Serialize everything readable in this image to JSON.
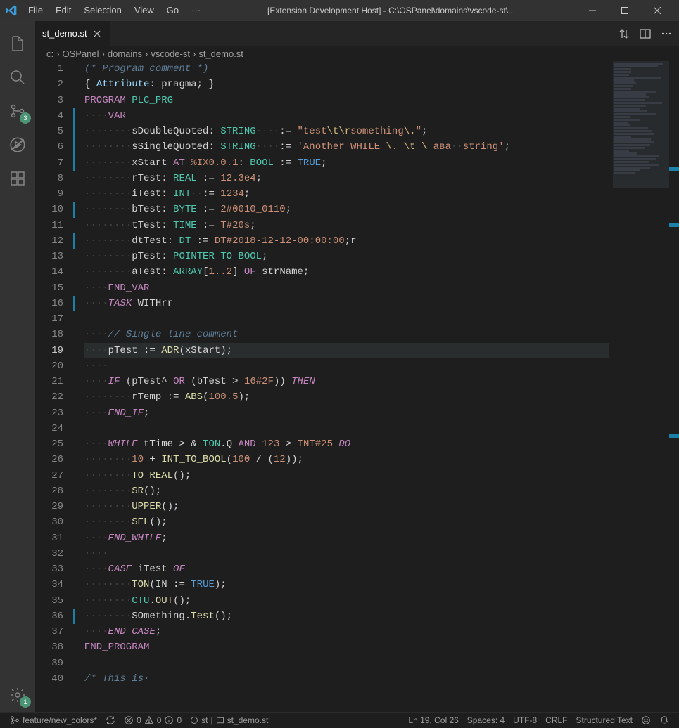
{
  "titlebar": {
    "menu": [
      "File",
      "Edit",
      "Selection",
      "View",
      "Go",
      "···"
    ],
    "title": "[Extension Development Host] - C:\\OSPanel\\domains\\vscode-st\\..."
  },
  "activitybar": {
    "scm_badge": "3",
    "settings_badge": "1"
  },
  "tabs": {
    "active": "st_demo.st"
  },
  "tabs_actions": {},
  "breadcrumbs": [
    "c:",
    "OSPanel",
    "domains",
    "vscode-st",
    "st_demo.st"
  ],
  "lines": {
    "1": {
      "segs": [
        {
          "t": "(* Program comment *)",
          "c": "c-comment"
        }
      ]
    },
    "2": {
      "segs": [
        {
          "t": "{ ",
          "c": "c-punct"
        },
        {
          "t": "Attribute",
          "c": "c-attr"
        },
        {
          "t": ": ",
          "c": "c-punct"
        },
        {
          "t": "pragma",
          "c": "c-ident"
        },
        {
          "t": "; }",
          "c": "c-punct"
        }
      ]
    },
    "3": {
      "segs": [
        {
          "t": "PROGRAM",
          "c": "c-keyword2"
        },
        {
          "t": " ",
          "c": ""
        },
        {
          "t": "PLC_PRG",
          "c": "c-type"
        }
      ]
    },
    "4": {
      "segs": [
        {
          "t": "····",
          "c": "ws"
        },
        {
          "t": "VAR",
          "c": "c-keyword2"
        }
      ]
    },
    "5": {
      "segs": [
        {
          "t": "········",
          "c": "ws"
        },
        {
          "t": "sDoubleQuoted",
          "c": "c-ident"
        },
        {
          "t": ": ",
          "c": "c-punct"
        },
        {
          "t": "STRING",
          "c": "c-type"
        },
        {
          "t": "····",
          "c": "ws"
        },
        {
          "t": ":= ",
          "c": "c-op"
        },
        {
          "t": "\"test",
          "c": "c-string"
        },
        {
          "t": "\\t\\r",
          "c": "c-special"
        },
        {
          "t": "something",
          "c": "c-string"
        },
        {
          "t": "\\.",
          "c": "c-special"
        },
        {
          "t": "\"",
          "c": "c-string"
        },
        {
          "t": ";",
          "c": "c-punct"
        }
      ]
    },
    "6": {
      "segs": [
        {
          "t": "········",
          "c": "ws"
        },
        {
          "t": "sSingleQuoted",
          "c": "c-ident"
        },
        {
          "t": ": ",
          "c": "c-punct"
        },
        {
          "t": "STRING",
          "c": "c-type"
        },
        {
          "t": "····",
          "c": "ws"
        },
        {
          "t": ":= ",
          "c": "c-op"
        },
        {
          "t": "'Another WHILE ",
          "c": "c-string"
        },
        {
          "t": "\\.",
          "c": "c-special"
        },
        {
          "t": " ",
          "c": "c-string"
        },
        {
          "t": "\\t",
          "c": "c-special"
        },
        {
          "t": " ",
          "c": "c-string"
        },
        {
          "t": "\\",
          "c": "c-special"
        },
        {
          "t": " ава",
          "c": "c-string"
        },
        {
          "t": "··",
          "c": "ws"
        },
        {
          "t": "string'",
          "c": "c-string"
        },
        {
          "t": ";",
          "c": "c-punct"
        }
      ]
    },
    "7": {
      "segs": [
        {
          "t": "········",
          "c": "ws"
        },
        {
          "t": "xStart",
          "c": "c-ident"
        },
        {
          "t": " ",
          "c": ""
        },
        {
          "t": "AT",
          "c": "c-keyword2"
        },
        {
          "t": " ",
          "c": ""
        },
        {
          "t": "%IX0.0.1",
          "c": "c-number"
        },
        {
          "t": ": ",
          "c": "c-punct"
        },
        {
          "t": "BOOL",
          "c": "c-type"
        },
        {
          "t": " := ",
          "c": "c-op"
        },
        {
          "t": "TRUE",
          "c": "c-bool"
        },
        {
          "t": ";",
          "c": "c-punct"
        }
      ]
    },
    "8": {
      "segs": [
        {
          "t": "········",
          "c": "ws"
        },
        {
          "t": "rTest",
          "c": "c-ident"
        },
        {
          "t": ": ",
          "c": "c-punct"
        },
        {
          "t": "REAL",
          "c": "c-type"
        },
        {
          "t": " := ",
          "c": "c-op"
        },
        {
          "t": "12.3e4",
          "c": "c-number"
        },
        {
          "t": ";",
          "c": "c-punct"
        }
      ]
    },
    "9": {
      "segs": [
        {
          "t": "········",
          "c": "ws"
        },
        {
          "t": "iTest",
          "c": "c-ident"
        },
        {
          "t": ": ",
          "c": "c-punct"
        },
        {
          "t": "INT",
          "c": "c-type"
        },
        {
          "t": "··",
          "c": "ws"
        },
        {
          "t": ":= ",
          "c": "c-op"
        },
        {
          "t": "1234",
          "c": "c-number"
        },
        {
          "t": ";",
          "c": "c-punct"
        }
      ]
    },
    "10": {
      "segs": [
        {
          "t": "········",
          "c": "ws"
        },
        {
          "t": "bTest",
          "c": "c-ident"
        },
        {
          "t": ": ",
          "c": "c-punct"
        },
        {
          "t": "BYTE",
          "c": "c-type"
        },
        {
          "t": " := ",
          "c": "c-op"
        },
        {
          "t": "2#0010_0110",
          "c": "c-number"
        },
        {
          "t": ";",
          "c": "c-punct"
        }
      ]
    },
    "11": {
      "segs": [
        {
          "t": "········",
          "c": "ws"
        },
        {
          "t": "tTest",
          "c": "c-ident"
        },
        {
          "t": ": ",
          "c": "c-punct"
        },
        {
          "t": "TIME",
          "c": "c-type"
        },
        {
          "t": " := ",
          "c": "c-op"
        },
        {
          "t": "T#20s",
          "c": "c-number"
        },
        {
          "t": ";",
          "c": "c-punct"
        }
      ]
    },
    "12": {
      "segs": [
        {
          "t": "········",
          "c": "ws"
        },
        {
          "t": "dtTest",
          "c": "c-ident"
        },
        {
          "t": ": ",
          "c": "c-punct"
        },
        {
          "t": "DT",
          "c": "c-type"
        },
        {
          "t": " := ",
          "c": "c-op"
        },
        {
          "t": "DT#2018-12-12-00:00:00",
          "c": "c-number"
        },
        {
          "t": ";",
          "c": "c-punct"
        },
        {
          "t": "r",
          "c": "c-ident"
        }
      ]
    },
    "13": {
      "segs": [
        {
          "t": "········",
          "c": "ws"
        },
        {
          "t": "pTest",
          "c": "c-ident"
        },
        {
          "t": ": ",
          "c": "c-punct"
        },
        {
          "t": "POINTER TO BOOL",
          "c": "c-type"
        },
        {
          "t": ";",
          "c": "c-punct"
        }
      ]
    },
    "14": {
      "segs": [
        {
          "t": "········",
          "c": "ws"
        },
        {
          "t": "aTest",
          "c": "c-ident"
        },
        {
          "t": ": ",
          "c": "c-punct"
        },
        {
          "t": "ARRAY",
          "c": "c-type"
        },
        {
          "t": "[",
          "c": "c-punct"
        },
        {
          "t": "1..2",
          "c": "c-number"
        },
        {
          "t": "] ",
          "c": "c-punct"
        },
        {
          "t": "OF",
          "c": "c-keyword2"
        },
        {
          "t": " ",
          "c": ""
        },
        {
          "t": "strName",
          "c": "c-ident"
        },
        {
          "t": ";",
          "c": "c-punct"
        }
      ]
    },
    "15": {
      "segs": [
        {
          "t": "····",
          "c": "ws"
        },
        {
          "t": "END_VAR",
          "c": "c-keyword2"
        }
      ]
    },
    "16": {
      "segs": [
        {
          "t": "····",
          "c": "ws"
        },
        {
          "t": "TASK",
          "c": "c-keyword"
        },
        {
          "t": " ",
          "c": ""
        },
        {
          "t": "WITHrr",
          "c": "c-ident"
        }
      ]
    },
    "17": {
      "segs": []
    },
    "18": {
      "segs": [
        {
          "t": "····",
          "c": "ws"
        },
        {
          "t": "// Single line comment",
          "c": "c-comment"
        }
      ]
    },
    "19": {
      "segs": [
        {
          "t": "····",
          "c": "ws"
        },
        {
          "t": "pTest",
          "c": "c-ident"
        },
        {
          "t": " := ",
          "c": "c-op"
        },
        {
          "t": "ADR",
          "c": "c-func"
        },
        {
          "t": "(",
          "c": "c-punct"
        },
        {
          "t": "xStart",
          "c": "c-ident"
        },
        {
          "t": ");",
          "c": "c-punct"
        }
      ]
    },
    "20": {
      "segs": [
        {
          "t": "····",
          "c": "ws"
        }
      ]
    },
    "21": {
      "segs": [
        {
          "t": "····",
          "c": "ws"
        },
        {
          "t": "IF",
          "c": "c-keyword"
        },
        {
          "t": " (",
          "c": "c-punct"
        },
        {
          "t": "pTest",
          "c": "c-ident"
        },
        {
          "t": "^ ",
          "c": "c-op"
        },
        {
          "t": "OR",
          "c": "c-keyword2"
        },
        {
          "t": " (",
          "c": "c-punct"
        },
        {
          "t": "bTest",
          "c": "c-ident"
        },
        {
          "t": " > ",
          "c": "c-op"
        },
        {
          "t": "16#2F",
          "c": "c-number"
        },
        {
          "t": ")) ",
          "c": "c-punct"
        },
        {
          "t": "THEN",
          "c": "c-keyword"
        }
      ]
    },
    "22": {
      "segs": [
        {
          "t": "········",
          "c": "ws"
        },
        {
          "t": "rTemp",
          "c": "c-ident"
        },
        {
          "t": " := ",
          "c": "c-op"
        },
        {
          "t": "ABS",
          "c": "c-func"
        },
        {
          "t": "(",
          "c": "c-punct"
        },
        {
          "t": "100.5",
          "c": "c-number"
        },
        {
          "t": ");",
          "c": "c-punct"
        }
      ]
    },
    "23": {
      "segs": [
        {
          "t": "····",
          "c": "ws"
        },
        {
          "t": "END_IF",
          "c": "c-keyword"
        },
        {
          "t": ";",
          "c": "c-punct"
        }
      ]
    },
    "24": {
      "segs": []
    },
    "25": {
      "segs": [
        {
          "t": "····",
          "c": "ws"
        },
        {
          "t": "WHILE",
          "c": "c-keyword"
        },
        {
          "t": " ",
          "c": ""
        },
        {
          "t": "tTime",
          "c": "c-ident"
        },
        {
          "t": " > & ",
          "c": "c-op"
        },
        {
          "t": "TON",
          "c": "c-type"
        },
        {
          "t": ".",
          "c": "c-punct"
        },
        {
          "t": "Q",
          "c": "c-ident"
        },
        {
          "t": " ",
          "c": ""
        },
        {
          "t": "AND",
          "c": "c-keyword2"
        },
        {
          "t": " ",
          "c": ""
        },
        {
          "t": "123",
          "c": "c-number"
        },
        {
          "t": " > ",
          "c": "c-op"
        },
        {
          "t": "INT#25",
          "c": "c-number"
        },
        {
          "t": " ",
          "c": ""
        },
        {
          "t": "DO",
          "c": "c-keyword"
        }
      ]
    },
    "26": {
      "segs": [
        {
          "t": "········",
          "c": "ws"
        },
        {
          "t": "10",
          "c": "c-number"
        },
        {
          "t": " + ",
          "c": "c-op"
        },
        {
          "t": "INT_TO_BOOL",
          "c": "c-func"
        },
        {
          "t": "(",
          "c": "c-punct"
        },
        {
          "t": "100",
          "c": "c-number"
        },
        {
          "t": " / (",
          "c": "c-op"
        },
        {
          "t": "12",
          "c": "c-number"
        },
        {
          "t": "));",
          "c": "c-punct"
        }
      ]
    },
    "27": {
      "segs": [
        {
          "t": "········",
          "c": "ws"
        },
        {
          "t": "TO_REAL",
          "c": "c-func"
        },
        {
          "t": "();",
          "c": "c-punct"
        }
      ]
    },
    "28": {
      "segs": [
        {
          "t": "········",
          "c": "ws"
        },
        {
          "t": "SR",
          "c": "c-func"
        },
        {
          "t": "();",
          "c": "c-punct"
        }
      ]
    },
    "29": {
      "segs": [
        {
          "t": "········",
          "c": "ws"
        },
        {
          "t": "UPPER",
          "c": "c-func"
        },
        {
          "t": "();",
          "c": "c-punct"
        }
      ]
    },
    "30": {
      "segs": [
        {
          "t": "········",
          "c": "ws"
        },
        {
          "t": "SEL",
          "c": "c-func"
        },
        {
          "t": "();",
          "c": "c-punct"
        }
      ]
    },
    "31": {
      "segs": [
        {
          "t": "····",
          "c": "ws"
        },
        {
          "t": "END_WHILE",
          "c": "c-keyword"
        },
        {
          "t": ";",
          "c": "c-punct"
        }
      ]
    },
    "32": {
      "segs": [
        {
          "t": "····",
          "c": "ws"
        }
      ]
    },
    "33": {
      "segs": [
        {
          "t": "····",
          "c": "ws"
        },
        {
          "t": "CASE",
          "c": "c-keyword"
        },
        {
          "t": " ",
          "c": ""
        },
        {
          "t": "iTest",
          "c": "c-ident"
        },
        {
          "t": " ",
          "c": ""
        },
        {
          "t": "OF",
          "c": "c-keyword"
        }
      ]
    },
    "34": {
      "segs": [
        {
          "t": "········",
          "c": "ws"
        },
        {
          "t": "TON",
          "c": "c-func"
        },
        {
          "t": "(",
          "c": "c-punct"
        },
        {
          "t": "IN",
          "c": "c-ident"
        },
        {
          "t": " := ",
          "c": "c-op"
        },
        {
          "t": "TRUE",
          "c": "c-bool"
        },
        {
          "t": ");",
          "c": "c-punct"
        }
      ]
    },
    "35": {
      "segs": [
        {
          "t": "········",
          "c": "ws"
        },
        {
          "t": "CTU",
          "c": "c-type"
        },
        {
          "t": ".",
          "c": "c-punct"
        },
        {
          "t": "OUT",
          "c": "c-func"
        },
        {
          "t": "();",
          "c": "c-punct"
        }
      ]
    },
    "36": {
      "segs": [
        {
          "t": "········",
          "c": "ws"
        },
        {
          "t": "SOmething",
          "c": "c-ident"
        },
        {
          "t": ".",
          "c": "c-punct"
        },
        {
          "t": "Test",
          "c": "c-func"
        },
        {
          "t": "();",
          "c": "c-punct"
        }
      ]
    },
    "37": {
      "segs": [
        {
          "t": "····",
          "c": "ws"
        },
        {
          "t": "END_CASE",
          "c": "c-keyword"
        },
        {
          "t": ";",
          "c": "c-punct"
        }
      ]
    },
    "38": {
      "segs": [
        {
          "t": "END_PROGRAM",
          "c": "c-keyword2"
        }
      ]
    },
    "39": {
      "segs": []
    },
    "40": {
      "segs": [
        {
          "t": "/* This is·",
          "c": "c-comment"
        }
      ]
    }
  },
  "modified_lines": [
    4,
    5,
    6,
    7,
    10,
    12,
    16,
    36
  ],
  "active_line": 19,
  "statusbar": {
    "branch": "feature/new_colors*",
    "errors": "0",
    "warnings": "0",
    "info": "0",
    "st_lang": "st",
    "file": "st_demo.st",
    "position": "Ln 19, Col 26",
    "spaces": "Spaces: 4",
    "encoding": "UTF-8",
    "eol": "CRLF",
    "language": "Structured Text"
  }
}
